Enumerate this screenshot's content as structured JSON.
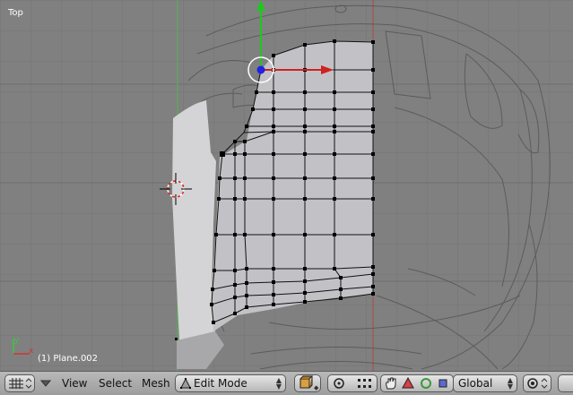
{
  "viewport": {
    "view_label": "Top",
    "object_label": "(1) Plane.002"
  },
  "header": {
    "menus": {
      "view": "View",
      "select": "Select",
      "mesh": "Mesh"
    },
    "mode": "Edit Mode",
    "orientation": "Global",
    "icons": [
      "viewport-grid-icon",
      "collapse-triangle-icon",
      "shading-icon",
      "pivot-icon",
      "snap-icon",
      "hand-icon",
      "scale-manipulator-icon",
      "rotate-manipulator-icon",
      "translate-manipulator-icon",
      "proportional-edit-icon"
    ]
  },
  "colors": {
    "background": "#808080",
    "grid": "#737373",
    "mesh_face": "#c8c8cc",
    "wire": "#000000",
    "x_axis": "#c83232",
    "y_axis": "#32c832",
    "z_axis": "#2828e6"
  }
}
